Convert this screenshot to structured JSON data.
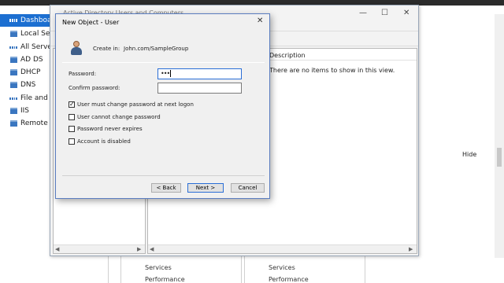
{
  "server_manager": {
    "nav": [
      {
        "label": "Dashboard",
        "active": true,
        "icon": "dashboard-icon"
      },
      {
        "label": "Local Server",
        "active": false,
        "icon": "server-icon"
      },
      {
        "label": "All Servers",
        "active": false,
        "icon": "servers-icon"
      },
      {
        "label": "AD DS",
        "active": false,
        "icon": "server-icon"
      },
      {
        "label": "DHCP",
        "active": false,
        "icon": "server-icon"
      },
      {
        "label": "DNS",
        "active": false,
        "icon": "server-icon"
      },
      {
        "label": "File and Storage Services",
        "active": false,
        "icon": "storage-icon"
      },
      {
        "label": "IIS",
        "active": false,
        "icon": "server-icon"
      },
      {
        "label": "Remote Access",
        "active": false,
        "icon": "server-icon"
      }
    ],
    "hide_label": "Hide",
    "tiles": [
      {
        "line1": "Services",
        "line2": "Performance"
      },
      {
        "line1": "Services",
        "line2": "Performance"
      }
    ]
  },
  "aduc": {
    "title": "Active Directory Users and Computers",
    "column_header": "Description",
    "empty_message": "There are no items to show in this view."
  },
  "dialog": {
    "title": "New Object - User",
    "create_in_label": "Create in:",
    "create_in_value": "John.com/SampleGroup",
    "password_label": "Password:",
    "password_value": "•••",
    "confirm_password_label": "Confirm password:",
    "confirm_password_value": "",
    "checkboxes": [
      {
        "label": "User must change password at next logon",
        "checked": true
      },
      {
        "label": "User cannot change password",
        "checked": false
      },
      {
        "label": "Password never expires",
        "checked": false
      },
      {
        "label": "Account is disabled",
        "checked": false
      }
    ],
    "buttons": {
      "back": "< Back",
      "next": "Next >",
      "cancel": "Cancel"
    }
  }
}
